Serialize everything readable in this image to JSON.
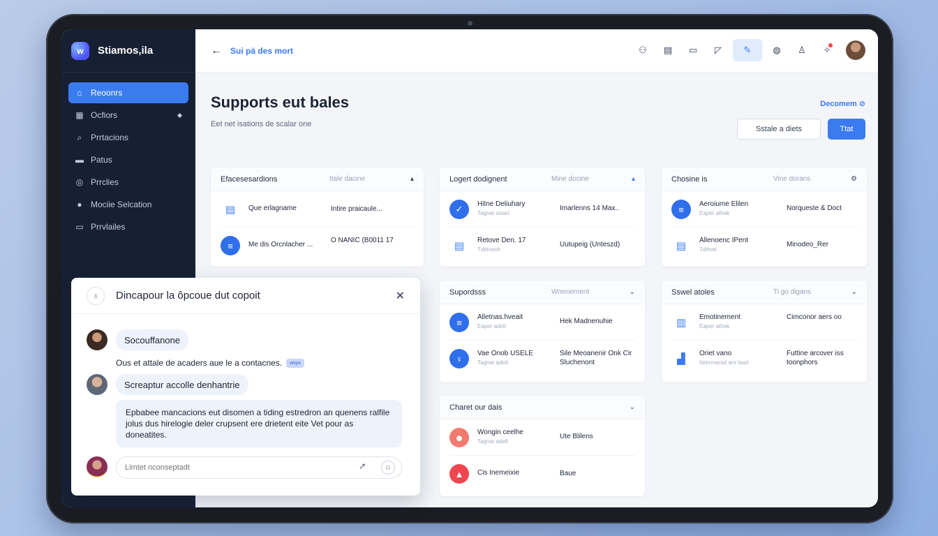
{
  "app": {
    "brand_logo": "w",
    "brand_name": "Stiamos,ila"
  },
  "sidebar": {
    "items": [
      {
        "icon": "home-icon",
        "glyph": "⌂",
        "label": "Reoonrs",
        "active": true
      },
      {
        "icon": "grid-icon",
        "glyph": "▦",
        "label": "Ocfiors",
        "active": false
      },
      {
        "icon": "search-icon",
        "glyph": "⌕",
        "label": "Prrtacions",
        "active": false
      },
      {
        "icon": "list-icon",
        "glyph": "▬",
        "label": "Patus",
        "active": false
      },
      {
        "icon": "compass-icon",
        "glyph": "◎",
        "label": "Prrclies",
        "active": false
      },
      {
        "icon": "user-icon",
        "glyph": "●",
        "label": "Mociie Selcation",
        "active": false
      },
      {
        "icon": "folder-icon",
        "glyph": "▭",
        "label": "Prrvlailes",
        "active": false
      }
    ]
  },
  "topbar": {
    "breadcrumb": "Sui pä des mort",
    "icons": [
      "people-icon",
      "clipboard-icon",
      "document-icon",
      "chart-icon",
      "pen-icon",
      "globe-icon",
      "person-icon",
      "notification-icon"
    ]
  },
  "page": {
    "title": "Supports eut bales",
    "subtitle": "Eet net isations de scalar one",
    "docs_link": "Decomem",
    "secondary_button": "Sstale a diets",
    "primary_button": "Ttat"
  },
  "cards": {
    "c1": {
      "title": "Efacesesardions",
      "col": "Itale dacine",
      "rows": [
        {
          "name": "Que erlagname",
          "value": "Intire praicaule..."
        },
        {
          "name": "Me dis Orcnlacher ...",
          "value": "O NANIC (B0011 17"
        }
      ]
    },
    "c2": {
      "title": "Logert dodignent",
      "col": "Mine docine",
      "rows": [
        {
          "name": "Hitne Deliuhary",
          "sub": "Tagnar sioarl",
          "value": "Imarlenns 14 Max.."
        },
        {
          "name": "Retove Den. 17",
          "sub": "Tdlrtveoh",
          "value": "Uutupeig (Unteszd)"
        }
      ]
    },
    "c3": {
      "title": "Chosine is",
      "col": "Vine dorans",
      "rows": [
        {
          "name": "Aeroiume Elilen",
          "sub": "Eaper athek",
          "value": "Norqueste & Doct"
        },
        {
          "name": "Allenoenc IPent",
          "sub": "Tdrtvet",
          "value": "Minodeo_Rer"
        }
      ]
    },
    "c4": {
      "title": "Supordsss",
      "col": "Wremement",
      "rows": [
        {
          "name": "Alletnas.hveait",
          "sub": "Eaper adetl",
          "value": "Hek Madnenuhie"
        },
        {
          "name": "Vae Onob USELE",
          "sub": "Tagnar adeit",
          "value": "Sile Meoanenir Onk Cir Sluchenont"
        }
      ]
    },
    "c5": {
      "title": "Sswel atoles",
      "col": "Ti go digans",
      "rows": [
        {
          "name": "Emotinement",
          "sub": "Eaper athek",
          "value": "Cimconor aers oo"
        },
        {
          "name": "Oriet vano",
          "sub": "Itetrnnacial anr laad",
          "value": "Futtine arcover iss toonphors"
        }
      ]
    },
    "c6": {
      "title": "Charet our dais",
      "col": "",
      "rows": [
        {
          "name": "Wongin ceelhe",
          "sub": "Tagnar adeit",
          "value": "Ute Blilens"
        },
        {
          "name": "Cis Inemeixie",
          "value": "Baue"
        }
      ]
    }
  },
  "chat": {
    "title": "Dincapour la ôpcoue dut copoit",
    "msg1": "Socouffanone",
    "msg_plain": "Ous et attale de acaders aue le a contacnes.",
    "msg_tag": "wsyx",
    "msg2": "Screaptur accolle denhantrie",
    "msg3": "Epbabee mancacions eut disomen a tiding estredron an quenens ralfile jolus dus hirelogie deler crupsent ere drietent eite Vet pour as doneatites.",
    "input_placeholder": "Limtet nconseptadt"
  },
  "colors": {
    "accent": "#3b7bf0",
    "sidebar_bg": "#172033",
    "danger": "#f0454f"
  }
}
